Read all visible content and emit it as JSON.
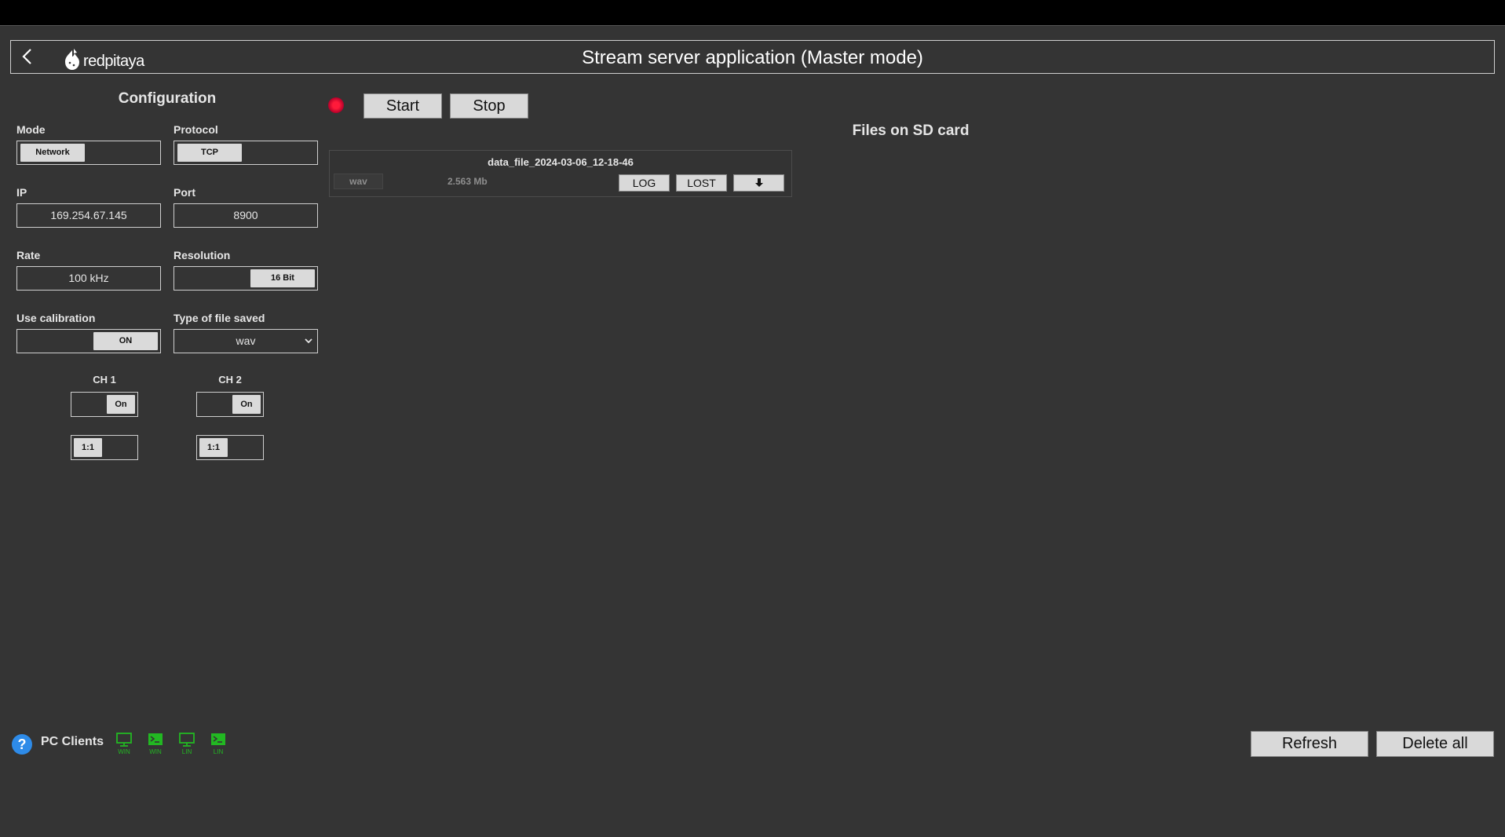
{
  "header": {
    "title": "Stream server application (Master mode)",
    "logo_text": "redpitaya"
  },
  "config": {
    "title": "Configuration",
    "mode": {
      "label": "Mode",
      "value": "Network"
    },
    "protocol": {
      "label": "Protocol",
      "value": "TCP"
    },
    "ip": {
      "label": "IP",
      "value": "169.254.67.145"
    },
    "port": {
      "label": "Port",
      "value": "8900"
    },
    "rate": {
      "label": "Rate",
      "value": "100 kHz"
    },
    "resolution": {
      "label": "Resolution",
      "value": "16 Bit"
    },
    "calibration": {
      "label": "Use calibration",
      "value": "ON"
    },
    "file_type": {
      "label": "Type of file saved",
      "value": "wav"
    },
    "channels": [
      {
        "label": "CH 1",
        "state": "On",
        "attenuation": "1:1"
      },
      {
        "label": "CH 2",
        "state": "On",
        "attenuation": "1:1"
      }
    ]
  },
  "controls": {
    "start_label": "Start",
    "stop_label": "Stop",
    "status_color": "#ff1a3a"
  },
  "files": {
    "title": "Files on SD card",
    "items": [
      {
        "name": "data_file_2024-03-06_12-18-46",
        "type": "wav",
        "size": "2.563 Mb",
        "log_label": "LOG",
        "lost_label": "LOST",
        "download_icon": "download-arrow-icon"
      }
    ],
    "refresh_label": "Refresh",
    "delete_all_label": "Delete all"
  },
  "footer": {
    "pc_clients_label": "PC Clients",
    "clients": [
      {
        "icon": "monitor-icon",
        "os": "WIN"
      },
      {
        "icon": "terminal-icon",
        "os": "WIN"
      },
      {
        "icon": "monitor-icon",
        "os": "LIN"
      },
      {
        "icon": "terminal-icon",
        "os": "LIN"
      }
    ],
    "client_color": "#22b822"
  }
}
